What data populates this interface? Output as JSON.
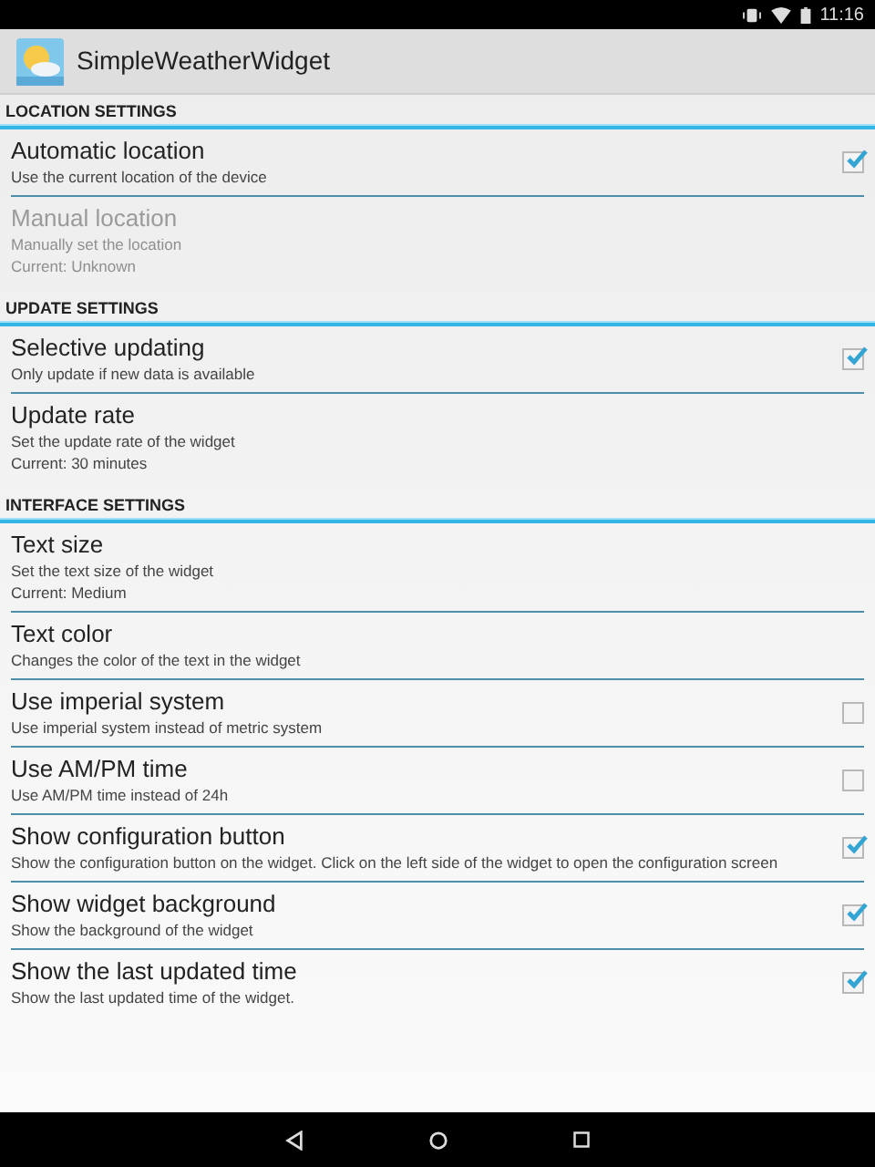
{
  "status_bar": {
    "time": "11:16"
  },
  "app_bar": {
    "title": "SimpleWeatherWidget"
  },
  "sections": [
    {
      "header": "LOCATION SETTINGS",
      "items": [
        {
          "kind": "checkbox",
          "title": "Automatic location",
          "summary": [
            "Use the current location of the device"
          ],
          "checked": true,
          "disabled": false
        },
        {
          "kind": "plain",
          "title": "Manual location",
          "summary": [
            "Manually set the location",
            "Current: Unknown"
          ],
          "disabled": true
        }
      ]
    },
    {
      "header": "UPDATE SETTINGS",
      "items": [
        {
          "kind": "checkbox",
          "title": "Selective updating",
          "summary": [
            "Only update if new data is available"
          ],
          "checked": true,
          "disabled": false
        },
        {
          "kind": "plain",
          "title": "Update rate",
          "summary": [
            "Set the update rate of the widget",
            "Current: 30 minutes"
          ],
          "disabled": false
        }
      ]
    },
    {
      "header": "INTERFACE SETTINGS",
      "items": [
        {
          "kind": "plain",
          "title": "Text size",
          "summary": [
            "Set the text size of the widget",
            "Current: Medium"
          ],
          "disabled": false
        },
        {
          "kind": "plain",
          "title": "Text color",
          "summary": [
            "Changes the color of the text in the widget"
          ],
          "disabled": false
        },
        {
          "kind": "checkbox",
          "title": "Use imperial system",
          "summary": [
            "Use imperial system instead of metric system"
          ],
          "checked": false,
          "disabled": false
        },
        {
          "kind": "checkbox",
          "title": "Use AM/PM time",
          "summary": [
            "Use AM/PM time instead of 24h"
          ],
          "checked": false,
          "disabled": false
        },
        {
          "kind": "checkbox",
          "title": "Show configuration button",
          "summary": [
            "Show the configuration button on the widget. Click on the left side of the widget to open the configuration screen"
          ],
          "checked": true,
          "disabled": false
        },
        {
          "kind": "checkbox",
          "title": "Show widget background",
          "summary": [
            "Show the background of the widget"
          ],
          "checked": true,
          "disabled": false
        },
        {
          "kind": "checkbox",
          "title": "Show the last updated time",
          "summary": [
            "Show the last updated time of the widget."
          ],
          "checked": true,
          "disabled": false
        }
      ]
    }
  ]
}
